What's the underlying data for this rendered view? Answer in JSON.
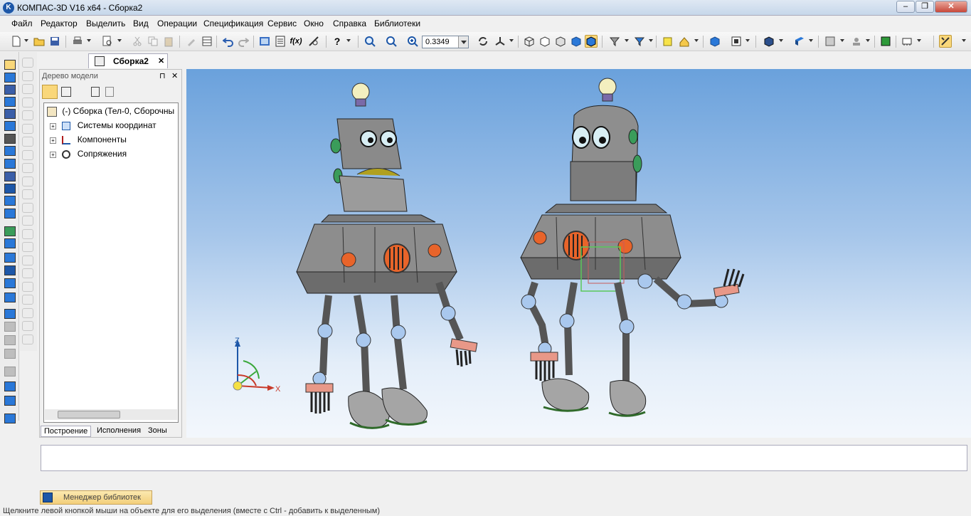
{
  "window": {
    "title": "КОМПАС-3D V16  x64 - Сборка2",
    "app_icon": "K",
    "minimize": "–",
    "restore": "❐",
    "close": "✕"
  },
  "menu": [
    "Файл",
    "Редактор",
    "Выделить",
    "Вид",
    "Операции",
    "Спецификация",
    "Сервис",
    "Окно",
    "Справка",
    "Библиотеки"
  ],
  "toolbar": {
    "zoom_value": "0.3349",
    "icons": [
      "new-file-icon",
      "open-file-icon",
      "save-icon",
      "print-icon",
      "preview-icon",
      "cut-icon",
      "copy-icon",
      "paste-icon",
      "properties-icon",
      "table-icon",
      "undo-icon",
      "redo-icon",
      "view-manager-icon",
      "variables-icon",
      "formula-icon",
      "measure-icon",
      "help-cursor-icon",
      "zoom-window-icon",
      "zoom-fit-icon",
      "zoom-scale-icon",
      "rotate-icon",
      "orient-icon",
      "wireframe-icon",
      "hidden-lines-icon",
      "halftone-icon",
      "shaded-icon",
      "shaded-edges-icon",
      "filter-icon",
      "snap-icon",
      "perspective-icon",
      "section-icon",
      "cube-icon",
      "light-icon",
      "book-icon",
      "assembly-icon",
      "part-icon",
      "spec-icon",
      "stamp-icon",
      "plug-icon",
      "sketch-icon",
      "snap-toggle-icon"
    ]
  },
  "doc_tab": {
    "label": "Сборка2",
    "close": "✕"
  },
  "tree_panel": {
    "title": "Дерево модели",
    "pin": "⊓",
    "close": "✕",
    "root": "(-) Сборка (Тел-0, Сборочны",
    "items": [
      "Системы координат",
      "Компоненты",
      "Сопряжения"
    ],
    "tabs": [
      "Построение",
      "Исполнения",
      "Зоны"
    ]
  },
  "axes": {
    "x": "X",
    "z": "Z"
  },
  "library_manager": "Менеджер библиотек",
  "status": "Щелкните левой кнопкой мыши на объекте для его выделения (вместе с Ctrl - добавить к выделенным)"
}
